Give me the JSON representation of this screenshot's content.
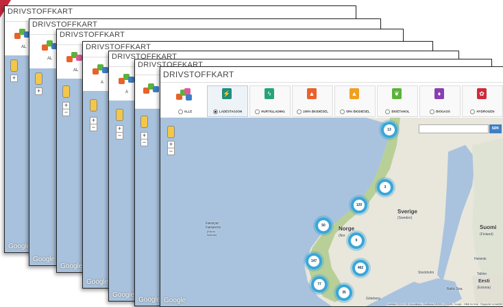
{
  "app_title": "DRIVSTOFFKART",
  "back_window_labels": [
    "AL",
    "AL",
    "AL",
    "A",
    "A"
  ],
  "filters": [
    {
      "label": "ALLE",
      "icon": "multi-fuel-icon",
      "color": "#e05a9a",
      "selected": false
    },
    {
      "label": "LADESTASJON",
      "icon": "charging-station-icon",
      "color": "#1f8f7a",
      "selected": true
    },
    {
      "label": "HURTIGLADING",
      "icon": "fast-charging-icon",
      "color": "#27a37c",
      "selected": false
    },
    {
      "label": "100% BIODIESEL",
      "icon": "biodiesel-100-icon",
      "color": "#e8622a",
      "selected": false
    },
    {
      "label": "50% BIODIESEL",
      "icon": "biodiesel-50-icon",
      "color": "#f0a020",
      "selected": false
    },
    {
      "label": "BIOETANOL",
      "icon": "bioethanol-icon",
      "color": "#5cb23a",
      "selected": false
    },
    {
      "label": "BIOGASS",
      "icon": "biogas-icon",
      "color": "#8a3fb0",
      "selected": false
    },
    {
      "label": "HYDROGEN",
      "icon": "hydrogen-icon",
      "color": "#d02a3a",
      "selected": false
    }
  ],
  "search": {
    "button_label": "SØK"
  },
  "map": {
    "clusters": [
      "13",
      "3",
      "120",
      "50",
      "9",
      "147",
      "462",
      "77",
      "35"
    ],
    "labels": {
      "sweden": "Sverige",
      "sweden_sub": "(Sweden)",
      "norway": "Norge",
      "norway_sub": "(Nor",
      "finland": "Suomi",
      "finland_sub": "(Finland)",
      "faroe": "Færøyar",
      "faroe2": "Færøerne",
      "faroe3": "(Faroe",
      "faroe4": "Islands)",
      "helsinki": "Helsinki",
      "stockholm": "Stockholm",
      "tallinn": "Tallinn",
      "eesti": "Eesti",
      "estonia": "(Estonia)",
      "baltic": "Baltic Sea",
      "goteborg": "Göteborg"
    },
    "google_logo": "Google",
    "attribution": "Kartdata ©2013 GIS Innovatiana, GeoBasis-DE/BKG (©2009), Google - Vilkår for bruk · Rapporter en kartfeil"
  }
}
